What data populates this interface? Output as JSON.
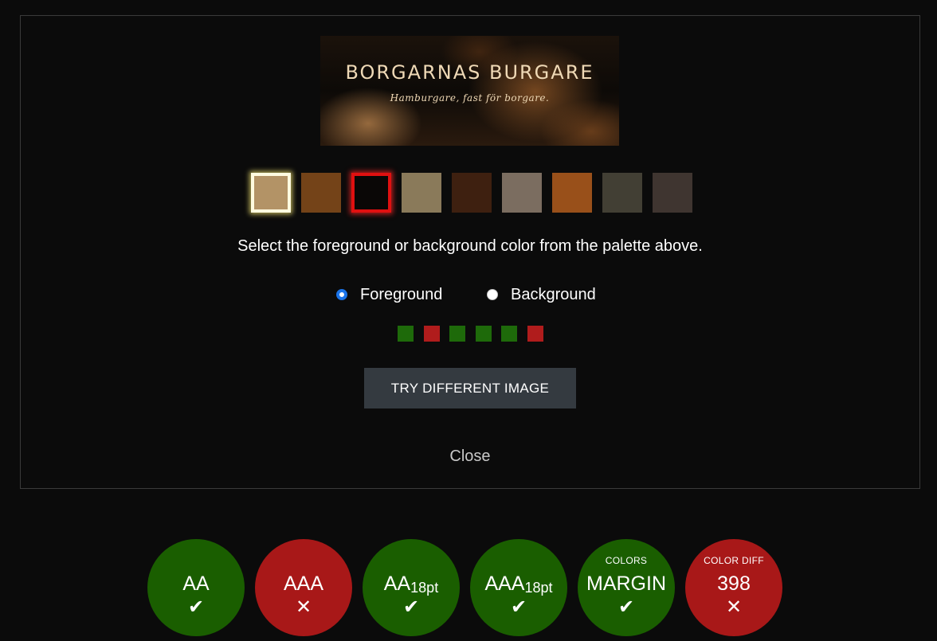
{
  "banner": {
    "title": "BORGARNAS BURGARE",
    "tagline": "Hamburgare, fast för borgare."
  },
  "palette": {
    "swatches": [
      {
        "color": "#b39366",
        "state": "foreground"
      },
      {
        "color": "#744318",
        "state": ""
      },
      {
        "color": "#0a0706",
        "state": "background"
      },
      {
        "color": "#8a7a5a",
        "state": ""
      },
      {
        "color": "#3e2010",
        "state": ""
      },
      {
        "color": "#7b6d60",
        "state": ""
      },
      {
        "color": "#99501a",
        "state": ""
      },
      {
        "color": "#423f34",
        "state": ""
      },
      {
        "color": "#3f3530",
        "state": ""
      }
    ]
  },
  "instructions": "Select the foreground or background color from the palette above.",
  "radios": {
    "foreground_label": "Foreground",
    "background_label": "Background",
    "selected": "foreground"
  },
  "indicators": [
    {
      "status": "pass",
      "color": "#1e6a0a"
    },
    {
      "status": "fail",
      "color": "#b01c1c"
    },
    {
      "status": "pass",
      "color": "#1e6a0a"
    },
    {
      "status": "pass",
      "color": "#1e6a0a"
    },
    {
      "status": "pass",
      "color": "#1e6a0a"
    },
    {
      "status": "fail",
      "color": "#b01c1c"
    }
  ],
  "try_button_label": "TRY DIFFERENT IMAGE",
  "close_label": "Close",
  "colors": {
    "pass": "#1a5e00",
    "fail": "#a81818",
    "button_bg": "#343a40"
  },
  "results": [
    {
      "top": "",
      "main": "AA",
      "sub": "",
      "status": "pass",
      "mark": "✔"
    },
    {
      "top": "",
      "main": "AAA",
      "sub": "",
      "status": "fail",
      "mark": "✕"
    },
    {
      "top": "",
      "main": "AA",
      "sub": "18pt",
      "status": "pass",
      "mark": "✔"
    },
    {
      "top": "",
      "main": "AAA",
      "sub": "18pt",
      "status": "pass",
      "mark": "✔"
    },
    {
      "top": "COLORS",
      "main": "MARGIN",
      "sub": "",
      "status": "pass",
      "mark": "✔"
    },
    {
      "top": "COLOR DIFF",
      "main": "398",
      "sub": "",
      "status": "fail",
      "mark": "✕"
    }
  ]
}
